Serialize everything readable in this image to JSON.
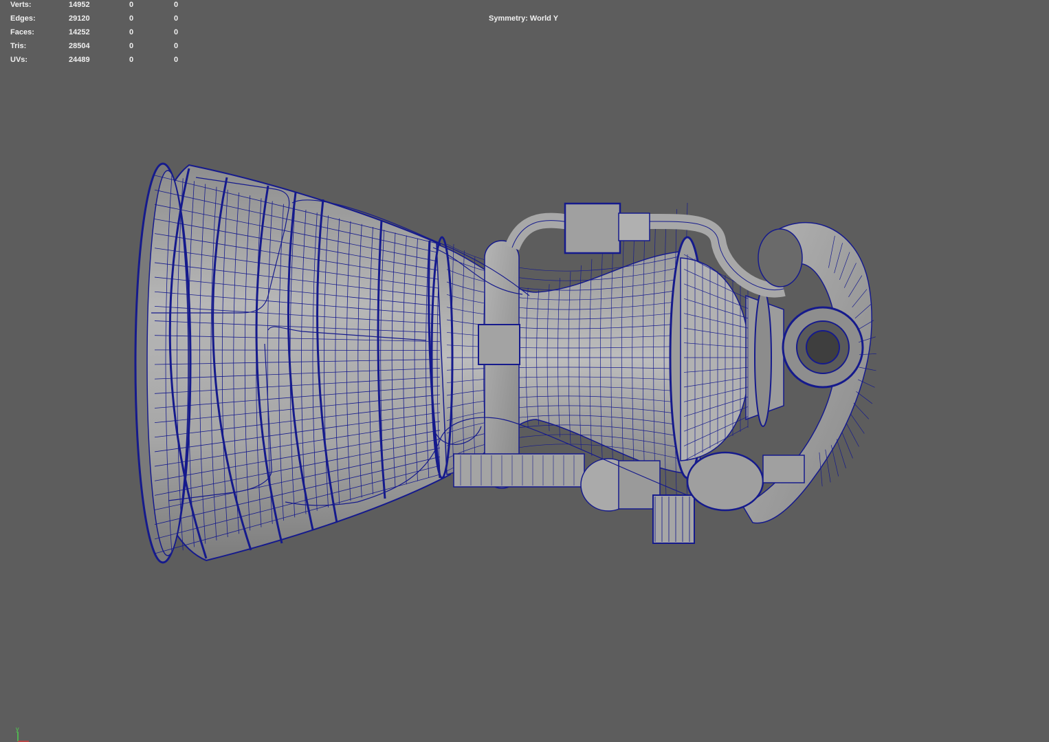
{
  "hud": {
    "stats": [
      {
        "label": "Verts:",
        "total": "14952",
        "selected": "0",
        "extra": "0"
      },
      {
        "label": "Edges:",
        "total": "29120",
        "selected": "0",
        "extra": "0"
      },
      {
        "label": "Faces:",
        "total": "14252",
        "selected": "0",
        "extra": "0"
      },
      {
        "label": "Tris:",
        "total": "28504",
        "selected": "0",
        "extra": "0"
      },
      {
        "label": "UVs:",
        "total": "24489",
        "selected": "0",
        "extra": "0"
      }
    ],
    "symmetry": "Symmetry: World Y"
  },
  "axis": {
    "y_label": "y"
  },
  "colors": {
    "background": "#5d5d5d",
    "mesh_fill": "#a9a9a9",
    "wire_color": "#151a8c",
    "hud_text": "#f0f0f0",
    "axis_y": "#4fd04f",
    "axis_x": "#d04040"
  }
}
